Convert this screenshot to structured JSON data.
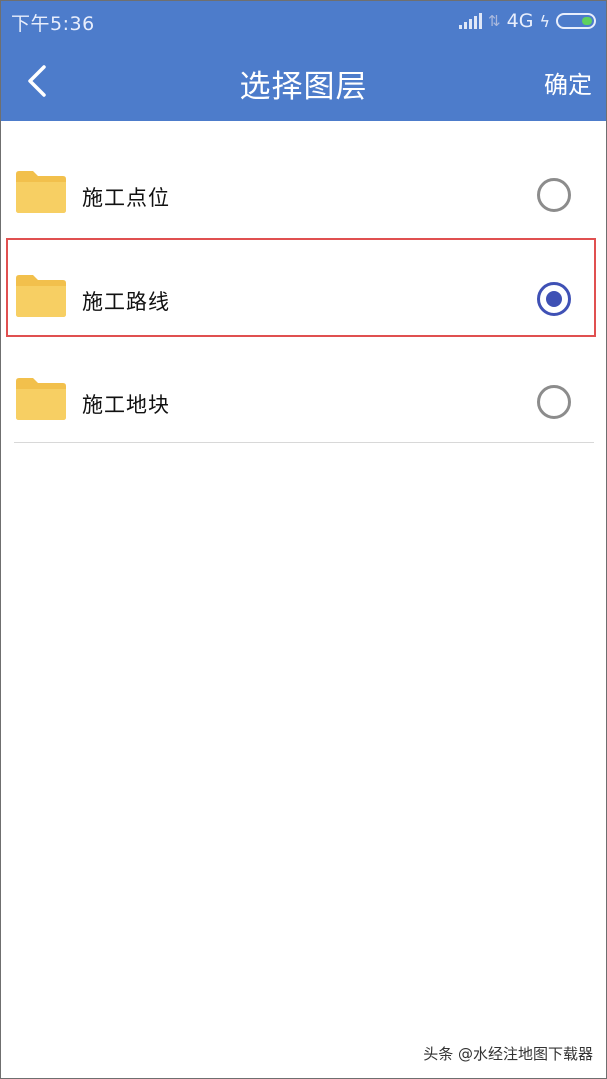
{
  "status_bar": {
    "time": "下午5:36",
    "network": "4G",
    "icons": [
      "signal-icon",
      "data-arrows-icon",
      "charging-bolt-icon",
      "battery-icon"
    ],
    "battery_color": "#5ed15e"
  },
  "header": {
    "back_icon": "chevron-left-icon",
    "title": "选择图层",
    "confirm_label": "确定",
    "background_color": "#4d7ccb"
  },
  "layers": [
    {
      "label": "施工点位",
      "selected": false,
      "icon": "folder-icon"
    },
    {
      "label": "施工路线",
      "selected": true,
      "icon": "folder-icon"
    },
    {
      "label": "施工地块",
      "selected": false,
      "icon": "folder-icon"
    }
  ],
  "colors": {
    "folder": "#f2c04c",
    "radio_selected": "#3f51b5",
    "highlight_box": "#e05050"
  },
  "watermark": "头条 @水经注地图下载器"
}
